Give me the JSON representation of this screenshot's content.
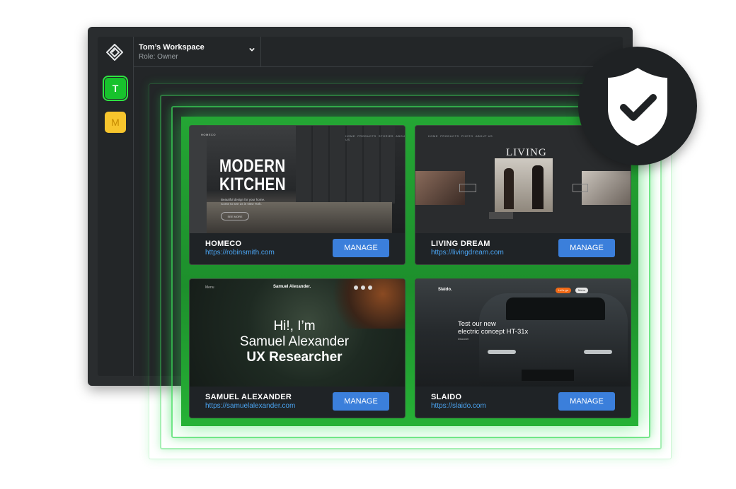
{
  "workspace": {
    "name": "Tom’s Workspace",
    "role": "Role: Owner"
  },
  "sidebar": {
    "avatars": [
      {
        "letter": "T",
        "color": "#17c22c"
      },
      {
        "letter": "M",
        "color": "#f7c52d"
      }
    ]
  },
  "cards": [
    {
      "name": "HOMECO",
      "url": "https://robinsmith.com",
      "button": "MANAGE",
      "preview": {
        "brand": "HOMECO",
        "headline_1": "MODERN",
        "headline_2": "KITCHEN",
        "sub_1": "Beautiful design for your home.",
        "sub_2": "Come to see us in New York.",
        "cta": "SEE MORE",
        "nav": [
          "HOME",
          "PRODUCTS",
          "STORIES",
          "ABOUT US"
        ]
      }
    },
    {
      "name": "LIVING DREAM",
      "url": "https://livingdream.com",
      "button": "MANAGE",
      "preview": {
        "headline": "LIVING",
        "nav": [
          "HOME",
          "PRODUCTS",
          "PHOTO",
          "ABOUT US"
        ]
      }
    },
    {
      "name": "SAMUEL ALEXANDER",
      "url": "https://samuelalexander.com",
      "button": "MANAGE",
      "preview": {
        "menu": "Menu",
        "brand": "Samuel Alexander.",
        "line_1": "Hi!, I’m",
        "line_2": "Samuel Alexander",
        "line_3": "UX Researcher"
      }
    },
    {
      "name": "SLAIDO",
      "url": "https://slaido.com",
      "button": "MANAGE",
      "preview": {
        "brand": "Slaido.",
        "line_1": "Test our new",
        "line_2": "electric concept HT-31x",
        "cta": "Discover",
        "pill": "Let’s go",
        "menu": "Menu"
      }
    }
  ],
  "colors": {
    "accent_green": "#1fc234",
    "button_blue": "#3b7fdb",
    "link_blue": "#4aa3f0",
    "window_bg": "#2a2d2f"
  },
  "icons": {
    "logo": "diamond-logo-icon",
    "chevron": "chevron-down-icon",
    "shield": "shield-check-icon"
  }
}
